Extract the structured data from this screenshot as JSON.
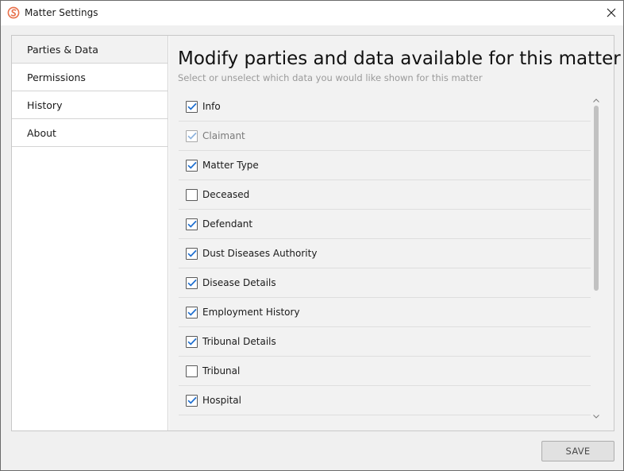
{
  "window": {
    "title": "Matter Settings",
    "icon": "app-logo-icon",
    "accent_color": "#e8704a"
  },
  "sidebar": {
    "items": [
      {
        "label": "Parties & Data",
        "active": true
      },
      {
        "label": "Permissions",
        "active": false
      },
      {
        "label": "History",
        "active": false
      },
      {
        "label": "About",
        "active": false
      }
    ]
  },
  "main": {
    "heading": "Modify parties and data available for this matter",
    "subheading": "Select or unselect which data you would like shown for this matter",
    "check_color": "#1f6fd0",
    "items": [
      {
        "label": "Info",
        "checked": true,
        "disabled": false
      },
      {
        "label": "Claimant",
        "checked": true,
        "disabled": true
      },
      {
        "label": "Matter Type",
        "checked": true,
        "disabled": false
      },
      {
        "label": "Deceased",
        "checked": false,
        "disabled": false
      },
      {
        "label": "Defendant",
        "checked": true,
        "disabled": false
      },
      {
        "label": "Dust Diseases Authority",
        "checked": true,
        "disabled": false
      },
      {
        "label": "Disease Details",
        "checked": true,
        "disabled": false
      },
      {
        "label": "Employment History",
        "checked": true,
        "disabled": false
      },
      {
        "label": "Tribunal Details",
        "checked": true,
        "disabled": false
      },
      {
        "label": "Tribunal",
        "checked": false,
        "disabled": false
      },
      {
        "label": "Hospital",
        "checked": true,
        "disabled": false
      }
    ]
  },
  "footer": {
    "save_label": "SAVE"
  }
}
